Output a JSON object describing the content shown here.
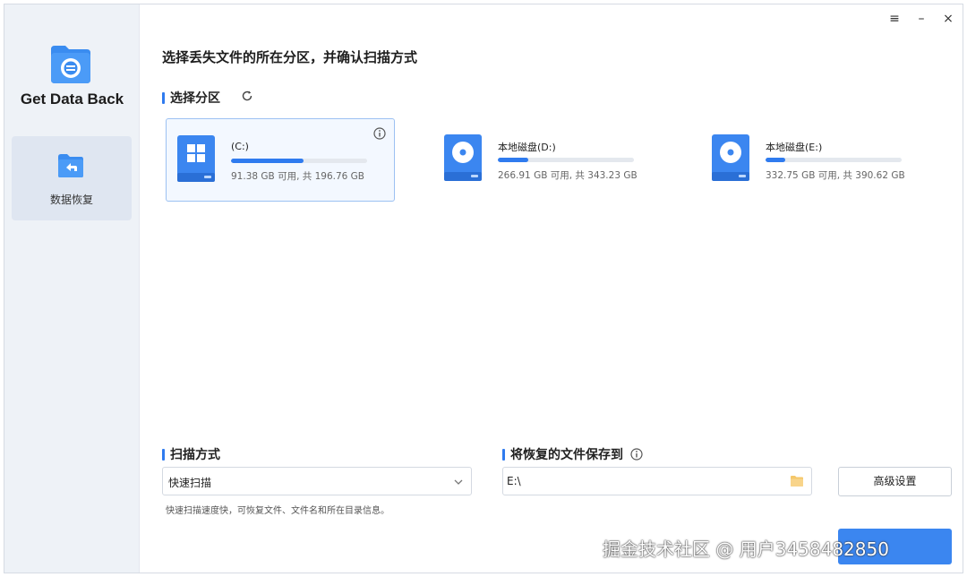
{
  "app": {
    "title": "Get Data Back"
  },
  "sidebar": {
    "items": [
      {
        "label": "数据恢复",
        "icon": "back-arrow-folder-icon"
      }
    ]
  },
  "window_controls": {
    "menu": "≡",
    "minimize": "–",
    "close": "×"
  },
  "main": {
    "title": "选择丢失文件的所在分区，并确认扫描方式",
    "partition_section": "选择分区",
    "drives": [
      {
        "name": "(C:)",
        "info": "91.38 GB 可用, 共 196.76 GB",
        "used_fraction": 0.536,
        "icon": "windows-drive-icon",
        "selected": true
      },
      {
        "name": "本地磁盘(D:)",
        "info": "266.91 GB 可用, 共 343.23 GB",
        "used_fraction": 0.222,
        "icon": "disk-drive-icon",
        "selected": false
      },
      {
        "name": "本地磁盘(E:)",
        "info": "332.75 GB 可用, 共 390.62 GB",
        "used_fraction": 0.148,
        "icon": "disk-drive-icon",
        "selected": false
      }
    ]
  },
  "scan": {
    "section": "扫描方式",
    "selected": "快速扫描",
    "hint": "快速扫描速度快，可恢复文件、文件名和所在目录信息。"
  },
  "save": {
    "section": "将恢复的文件保存到",
    "path": "E:\\"
  },
  "buttons": {
    "advanced": "高级设置"
  },
  "watermark": "掘金技术社区 @ 用户3458482850",
  "colors": {
    "accent": "#2f7bef",
    "sidebar_bg": "#eef2f7",
    "selected_card_bg": "#f3f8ff"
  }
}
